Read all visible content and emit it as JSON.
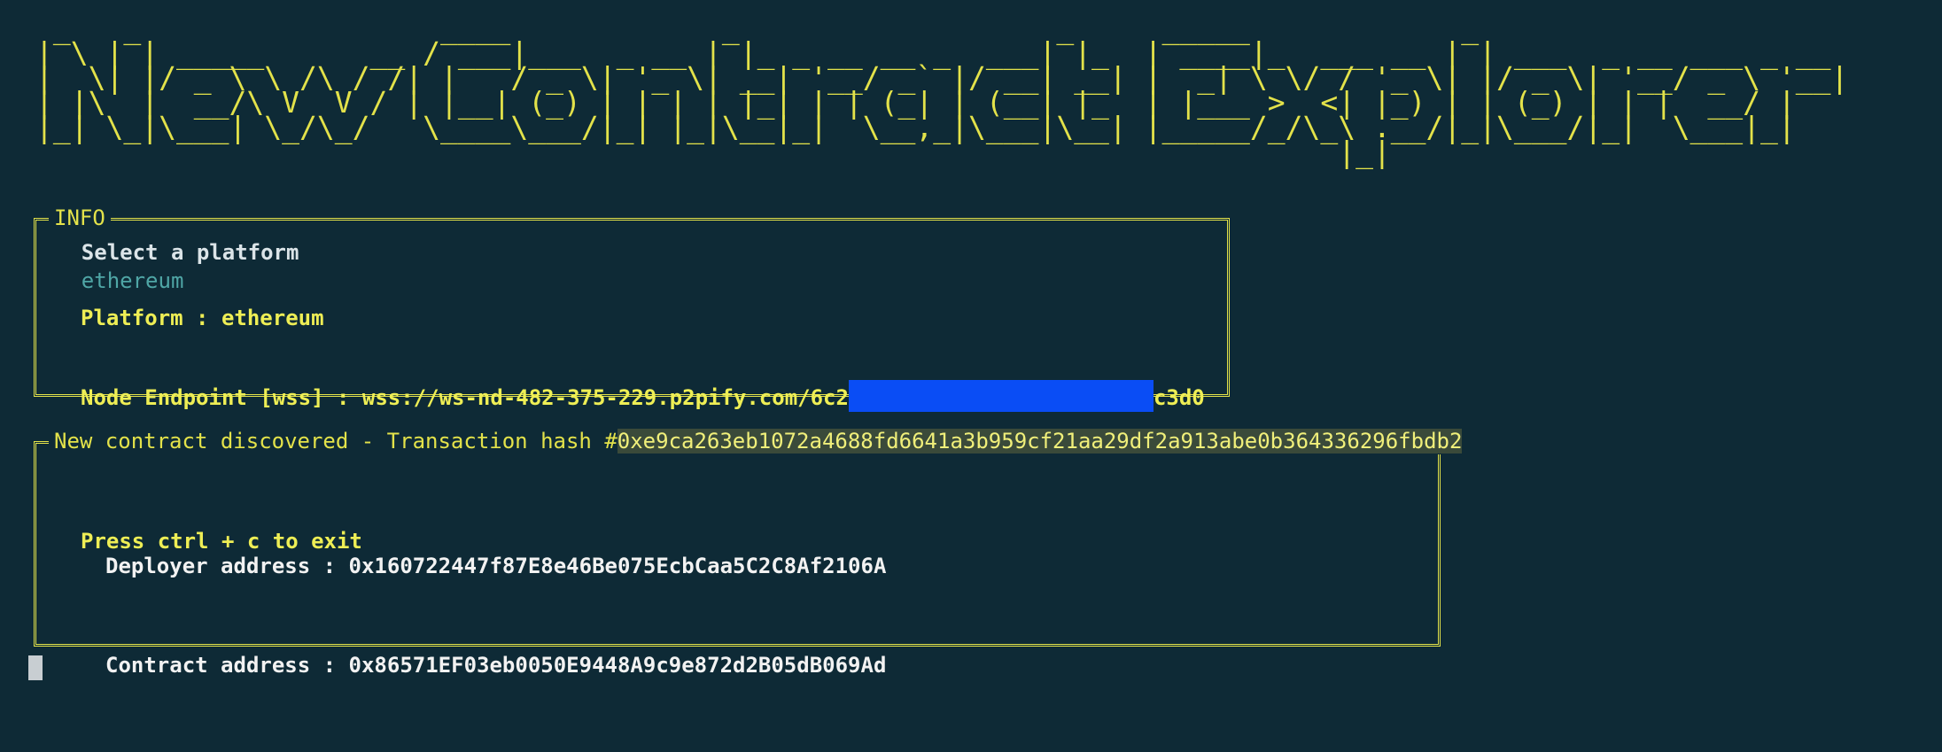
{
  "banner": {
    "text": " _   _                 ____            _                  _     _____            _                     \n| \\ | | _____      __ / ___|___  _ __ | |_ _ __ __ _  ___| |_  | ____|_  ___ __ | | ___  _ __ ___ _ __ \n|  \\| |/ _ \\ \\ /\\ / /| |   / _ \\| '_ \\| __| '__/ _` |/ __| __| |  _| \\ \\/ / '_ \\| |/ _ \\| '__/ _ \\ '__|\n| |\\  |  __/\\ V  V / | |__| (_) | | | | |_| | | (_| | (__| |_  | |___ >  <| |_) | | (_) | | |  __/ |   \n|_| \\_|\\___| \\_/\\_/   \\____\\___/|_| |_|\\__|_|  \\__,_|\\___|\\__| |_____/_/\\_\\ .__/|_|\\___/|_|  \\___|_|   \n                                                                          |_|                          "
  },
  "prompt": {
    "qmark": "?",
    "question": "Select a platform",
    "answer": "ethereum"
  },
  "info_box": {
    "title": "INFO",
    "platform_line": "Platform : ethereum",
    "endpoint_prefix": "Node Endpoint [wss] : wss://ws-nd-482-375-229.p2pify.com/6c2",
    "endpoint_suffix": "c3d0",
    "exit_line": "Press ctrl + c to exit"
  },
  "tx_box": {
    "title_prefix": "New contract discovered - Transaction hash #",
    "hash": "0xe9ca263eb1072a4688fd6641a3b959cf21aa29df2a913abe0b364336296fbdb2",
    "deployer_line": "Deployer address : 0x160722447f87E8e46Be075EcbCaa5C2C8Af2106A",
    "contract_line": "Contract address : 0x86571EF03eb0050E9448A9c9e872d2B05dB069Ad"
  },
  "colors": {
    "background": "#0e2a36",
    "accent_yellow": "#e3e24a",
    "redaction": "#0a4df5"
  }
}
